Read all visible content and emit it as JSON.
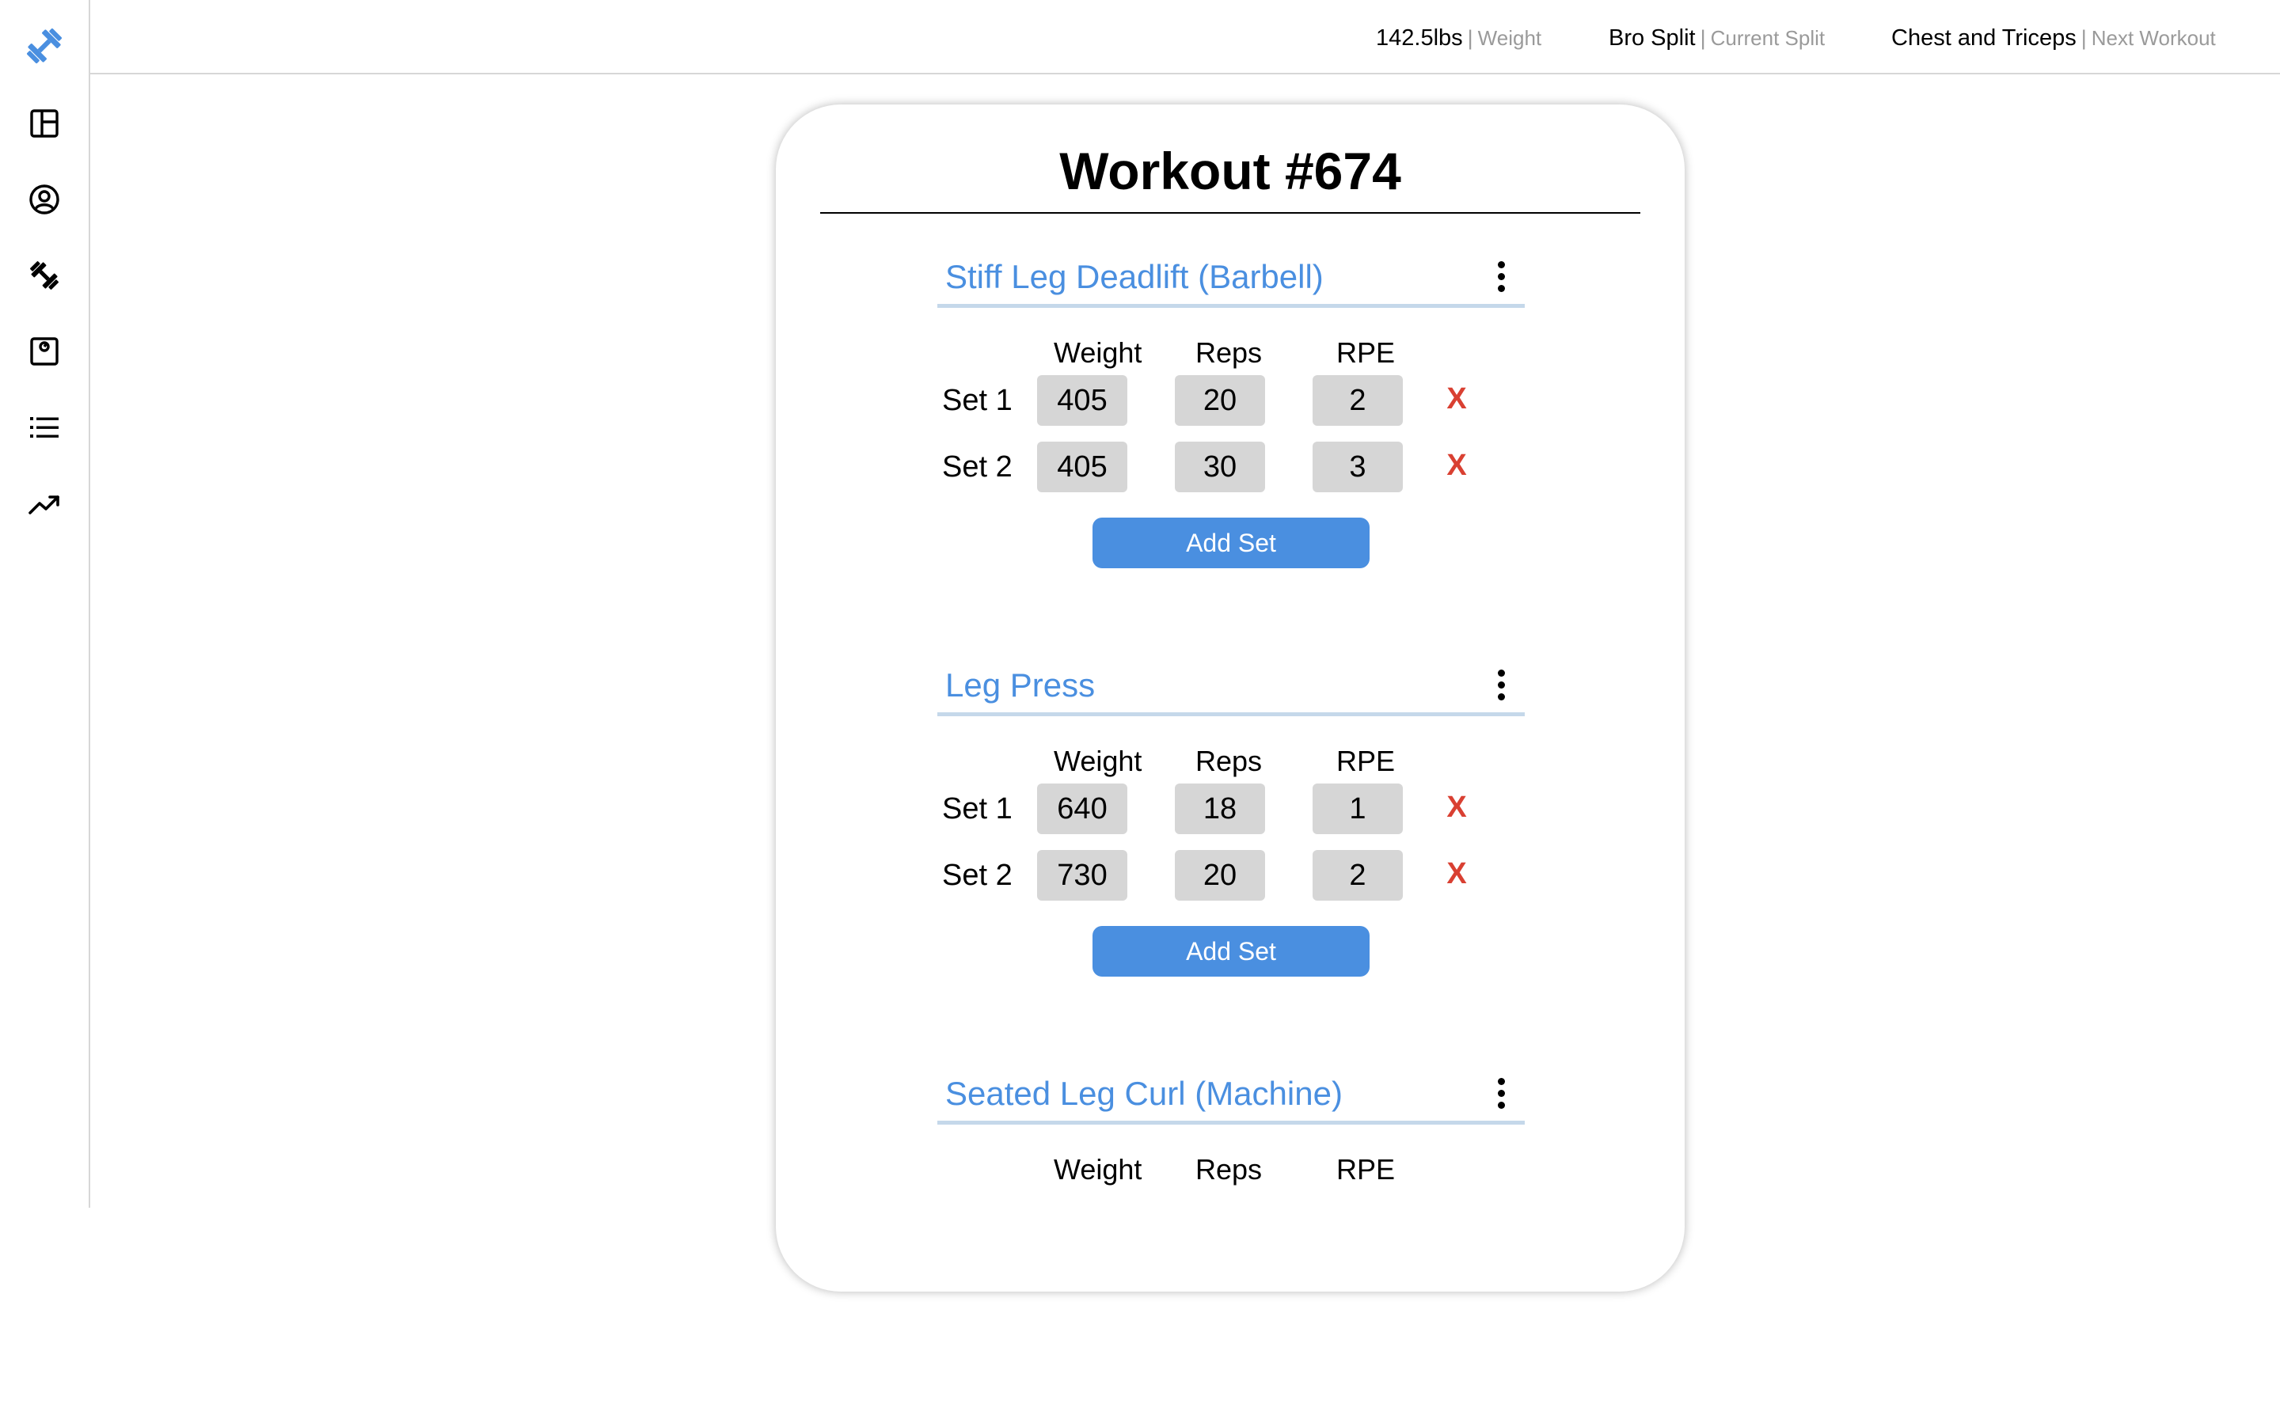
{
  "sidebar": {
    "items": [
      {
        "icon": "dumbbell-logo-icon",
        "color": "#4a8fe0"
      },
      {
        "icon": "dashboard-icon"
      },
      {
        "icon": "profile-icon"
      },
      {
        "icon": "exercise-icon"
      },
      {
        "icon": "scale-icon"
      },
      {
        "icon": "list-icon"
      },
      {
        "icon": "progress-trend-icon"
      }
    ]
  },
  "header": {
    "stats": [
      {
        "value": "142.5lbs",
        "separator": "|",
        "label": "Weight"
      },
      {
        "value": "Bro Split",
        "separator": "|",
        "label": "Current Split"
      },
      {
        "value": "Chest and Triceps",
        "separator": "|",
        "label": "Next Workout"
      }
    ]
  },
  "workout": {
    "title": "Workout #674",
    "columns": [
      "Weight",
      "Reps",
      "RPE"
    ],
    "delete_label": "X",
    "add_set_label": "Add Set",
    "exercises": [
      {
        "name": "Stiff Leg Deadlift (Barbell)",
        "sets": [
          {
            "label": "Set 1",
            "weight": "405",
            "reps": "20",
            "rpe": "2"
          },
          {
            "label": "Set 2",
            "weight": "405",
            "reps": "30",
            "rpe": "3"
          }
        ]
      },
      {
        "name": "Leg Press",
        "sets": [
          {
            "label": "Set 1",
            "weight": "640",
            "reps": "18",
            "rpe": "1"
          },
          {
            "label": "Set 2",
            "weight": "730",
            "reps": "20",
            "rpe": "2"
          }
        ]
      },
      {
        "name": "Seated Leg Curl (Machine)",
        "sets": []
      }
    ]
  },
  "colors": {
    "accent": "#4a8fe0",
    "delete": "#d94032",
    "input_bg": "#d6d6d6",
    "muted_text": "#9a9a9a"
  }
}
